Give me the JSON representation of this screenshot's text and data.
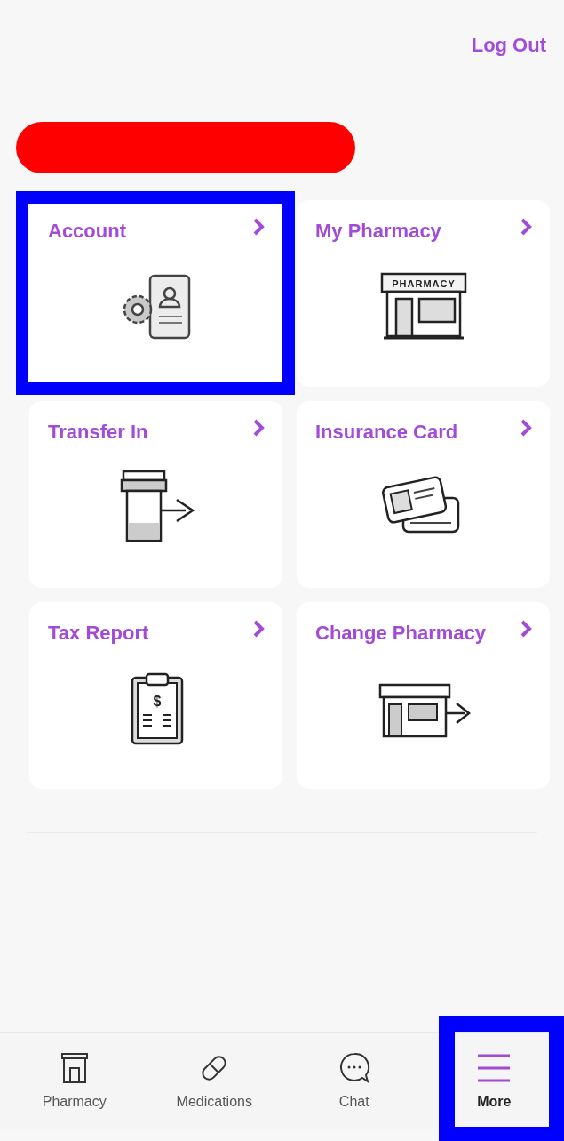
{
  "header": {
    "logout": "Log Out",
    "redacted_name": true
  },
  "tiles": [
    {
      "title": "Account",
      "highlighted": true
    },
    {
      "title": "My Pharmacy",
      "sign": "PHARMACY",
      "highlighted": false
    },
    {
      "title": "Transfer In",
      "highlighted": false
    },
    {
      "title": "Insurance Card",
      "highlighted": false
    },
    {
      "title": "Tax Report",
      "sign": "$",
      "highlighted": false
    },
    {
      "title": "Change Pharmacy",
      "highlighted": false
    }
  ],
  "bottom_nav": [
    {
      "label": "Pharmacy",
      "selected": false,
      "highlighted": false
    },
    {
      "label": "Medications",
      "selected": false,
      "highlighted": false
    },
    {
      "label": "Chat",
      "selected": false,
      "highlighted": false
    },
    {
      "label": "More",
      "selected": true,
      "highlighted": true
    }
  ]
}
